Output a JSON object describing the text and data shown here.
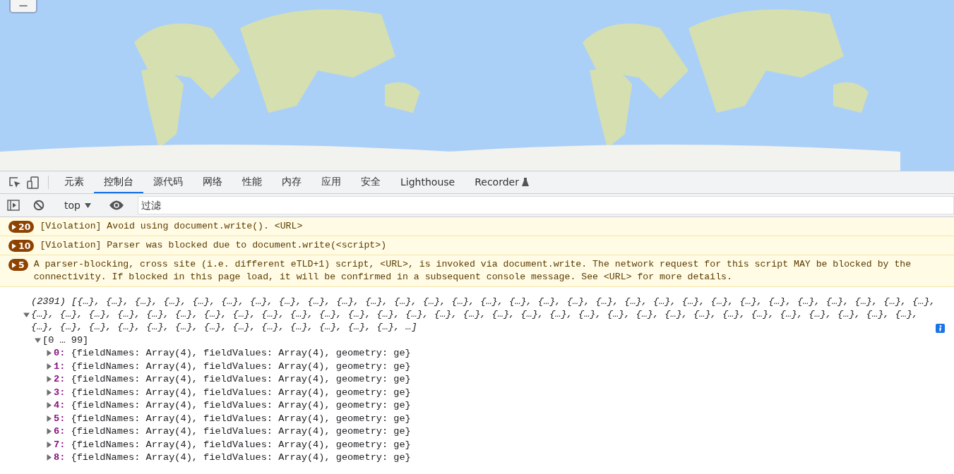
{
  "map": {
    "zoom_button": "−"
  },
  "devtools": {
    "tabs": [
      {
        "label": "元素",
        "selected": false
      },
      {
        "label": "控制台",
        "selected": true
      },
      {
        "label": "源代码",
        "selected": false
      },
      {
        "label": "网络",
        "selected": false
      },
      {
        "label": "性能",
        "selected": false
      },
      {
        "label": "内存",
        "selected": false
      },
      {
        "label": "应用",
        "selected": false
      },
      {
        "label": "安全",
        "selected": false
      },
      {
        "label": "Lighthouse",
        "selected": false
      },
      {
        "label": "Recorder",
        "selected": false,
        "experimental": true
      }
    ],
    "toolbar": {
      "context": "top",
      "filter": {
        "placeholder": "过滤"
      }
    },
    "messages": [
      {
        "count": "20",
        "text": "[Violation] Avoid using document.write(). <URL>"
      },
      {
        "count": "10",
        "text": "[Violation] Parser was blocked due to document.write(<script>)"
      },
      {
        "count": "5",
        "text": "A parser-blocking, cross site (i.e. different eTLD+1) script, <URL>, is invoked via document.write. The network request for this script MAY be blocked by the\nconnectivity. If blocked in this page load, it will be confirmed in a subsequent console message. See <URL> for more details."
      }
    ],
    "array_log": {
      "expanded": true,
      "lines": [
        "(2391) [{…}, {…}, {…}, {…}, {…}, {…}, {…}, {…}, {…}, {…}, {…}, {…}, {…}, {…}, {…}, {…}, {…}, {…}, {…}, {…}, {…}, {…}, {…}, {…}, {…}, {…}, {…}, {…}, {…}, {…},",
        "{…}, {…}, {…}, {…}, {…}, {…}, {…}, {…}, {…}, {…}, {…}, {…}, {…}, {…}, {…}, {…}, {…}, {…}, {…}, {…}, {…}, {…}, {…}, {…}, {…}, {…}, {…}, {…}, {…}, {…}, {…},",
        "{…}, {…}, {…}, {…}, {…}, {…}, {…}, {…}, {…}, {…}, {…}, {…}, {…}, …]"
      ],
      "children": [
        {
          "label": "[0 … 99]",
          "expanded": true,
          "children": [
            {
              "index": "0:",
              "preview": "{fieldNames: Array(4), fieldValues: Array(4), geometry: ge}",
              "expanded": false
            },
            {
              "index": "1:",
              "preview": "{fieldNames: Array(4), fieldValues: Array(4), geometry: ge}",
              "expanded": false
            },
            {
              "index": "2:",
              "preview": "{fieldNames: Array(4), fieldValues: Array(4), geometry: ge}",
              "expanded": false
            },
            {
              "index": "3:",
              "preview": "{fieldNames: Array(4), fieldValues: Array(4), geometry: ge}",
              "expanded": false
            },
            {
              "index": "4:",
              "preview": "{fieldNames: Array(4), fieldValues: Array(4), geometry: ge}",
              "expanded": false
            },
            {
              "index": "5:",
              "preview": "{fieldNames: Array(4), fieldValues: Array(4), geometry: ge}",
              "expanded": false
            },
            {
              "index": "6:",
              "preview": "{fieldNames: Array(4), fieldValues: Array(4), geometry: ge}",
              "expanded": false
            },
            {
              "index": "7:",
              "preview": "{fieldNames: Array(4), fieldValues: Array(4), geometry: ge}",
              "expanded": false
            },
            {
              "index": "8:",
              "preview": "{fieldNames: Array(4), fieldValues: Array(4), geometry: ge}",
              "expanded": false
            }
          ]
        }
      ]
    }
  }
}
